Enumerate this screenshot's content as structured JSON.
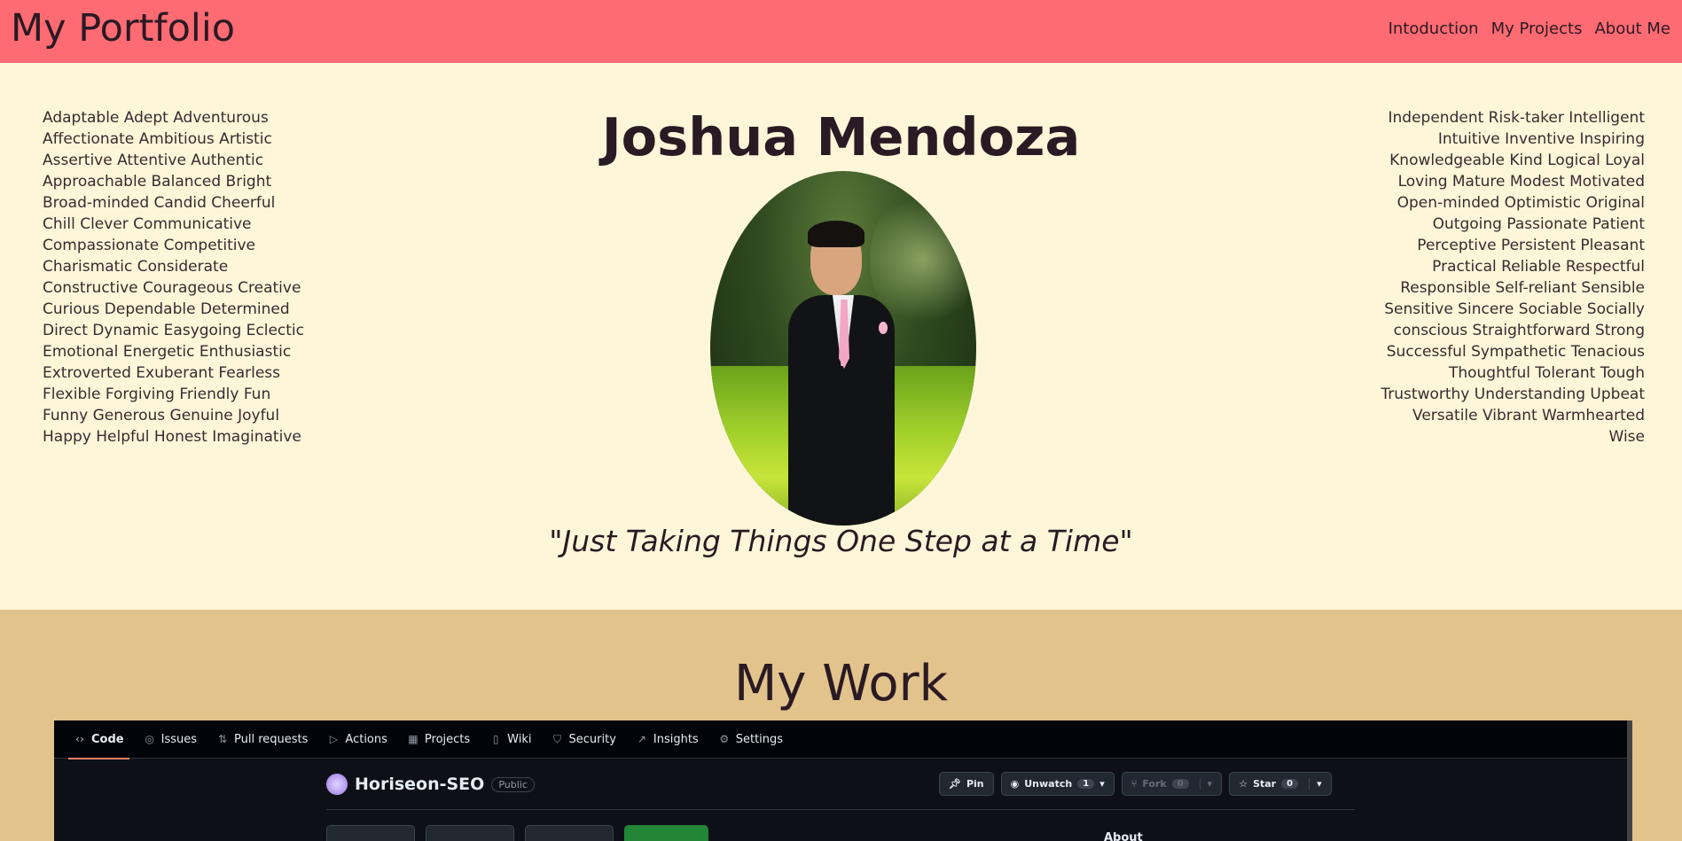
{
  "header": {
    "brand": "My Portfolio",
    "nav": [
      "Intoduction",
      "My Projects",
      "About Me"
    ]
  },
  "intro": {
    "name": "Joshua Mendoza",
    "quote": "\"Just Taking Things One Step at a Time\"",
    "traits_left": [
      "Adaptable Adept Adventurous",
      "Affectionate Ambitious Artistic",
      "Assertive Attentive Authentic",
      "Approachable Balanced Bright",
      "Broad-minded Candid Cheerful",
      "Chill Clever Communicative",
      "Compassionate Competitive",
      "Charismatic Considerate",
      "Constructive Courageous Creative",
      "Curious Dependable Determined",
      "Direct Dynamic Easygoing Eclectic",
      "Emotional Energetic Enthusiastic",
      "Extroverted Exuberant Fearless",
      "Flexible Forgiving Friendly Fun",
      "Funny Generous Genuine Joyful",
      "Happy Helpful Honest Imaginative"
    ],
    "traits_right": [
      "Independent Risk-taker Intelligent",
      "Intuitive Inventive Inspiring",
      "Knowledgeable Kind Logical Loyal",
      "Loving Mature Modest Motivated",
      "Open-minded Optimistic Original",
      "Outgoing Passionate Patient",
      "Perceptive Persistent Pleasant",
      "Practical Reliable Respectful",
      "Responsible Self-reliant Sensible",
      "Sensitive Sincere Sociable Socially",
      "conscious Straightforward Strong",
      "Successful Sympathetic Tenacious",
      "Thoughtful Tolerant Tough",
      "Trustworthy Understanding Upbeat",
      "Versatile Vibrant Warmhearted",
      "Wise"
    ]
  },
  "work": {
    "title": "My Work",
    "screenshot": {
      "tabs": [
        {
          "label": "Code",
          "icon": "code-icon",
          "glyph": "‹›"
        },
        {
          "label": "Issues",
          "icon": "issue-icon",
          "glyph": "◎"
        },
        {
          "label": "Pull requests",
          "icon": "pull-request-icon",
          "glyph": "⇅"
        },
        {
          "label": "Actions",
          "icon": "play-icon",
          "glyph": "▷"
        },
        {
          "label": "Projects",
          "icon": "table-icon",
          "glyph": "▦"
        },
        {
          "label": "Wiki",
          "icon": "book-icon",
          "glyph": "▯"
        },
        {
          "label": "Security",
          "icon": "shield-icon",
          "glyph": "⛉"
        },
        {
          "label": "Insights",
          "icon": "graph-icon",
          "glyph": "↗"
        },
        {
          "label": "Settings",
          "icon": "gear-icon",
          "glyph": "⚙"
        }
      ],
      "repo_name": "Horiseon-SEO",
      "visibility": "Public",
      "pin_label": "Pin",
      "unwatch_label": "Unwatch",
      "unwatch_count": "1",
      "fork_label": "Fork",
      "fork_count": "0",
      "star_label": "Star",
      "star_count": "0",
      "about_label": "About"
    }
  },
  "colors": {
    "header_bg": "#ff6b72",
    "intro_bg": "#fef6d8",
    "work_bg": "#e3c38c",
    "text": "#2a1a24"
  }
}
